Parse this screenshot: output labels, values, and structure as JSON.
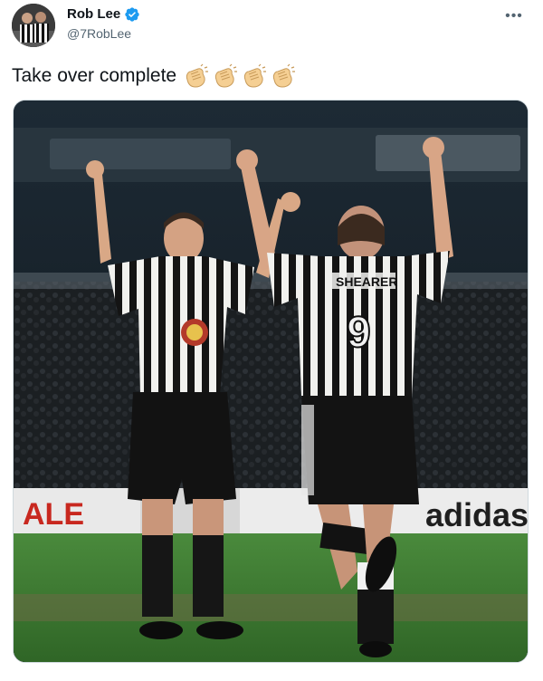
{
  "tweet": {
    "author": {
      "display_name": "Rob Lee",
      "handle": "@7RobLee",
      "verified": true,
      "avatar_icon": "avatar-photo-icon"
    },
    "more_label": "•••",
    "text": "Take over complete",
    "emojis": [
      "clapping-hands",
      "clapping-hands",
      "clapping-hands",
      "clapping-hands"
    ],
    "media": {
      "shirt_name": "SHEARER",
      "shirt_number": "9",
      "board_text": "adidas"
    }
  },
  "colors": {
    "verified_blue": "#1d9bf0",
    "handle_gray": "#536471",
    "text_black": "#0f1419",
    "pitch_green": "#3f7a34",
    "clap_skin": "#f5cf93"
  }
}
